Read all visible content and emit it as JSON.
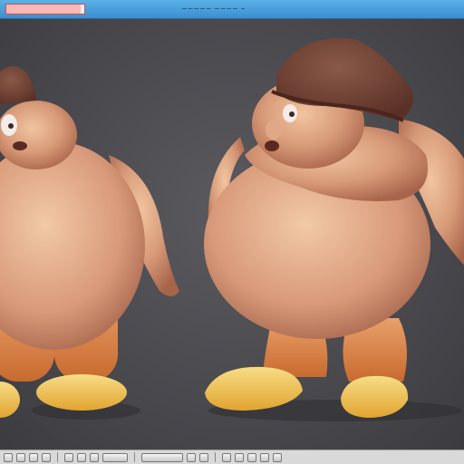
{
  "window": {
    "title": "~~~~~ ~~~~ ~~~~~",
    "tab_progress": 0.95,
    "accent_color": "#3b8fcf"
  },
  "viewport": {
    "background_color": "#4a4a4e",
    "content": "3d-character-model"
  },
  "toolbar": {
    "icons": [
      "select-tool-icon",
      "move-tool-icon",
      "rotate-tool-icon",
      "scale-tool-icon",
      "camera-icon",
      "light-icon",
      "mesh-icon",
      "material-icon",
      "render-icon",
      "grid-icon",
      "snap-icon",
      "layer-icon",
      "settings-icon",
      "view-icon",
      "zoom-icon",
      "frame-icon"
    ]
  }
}
